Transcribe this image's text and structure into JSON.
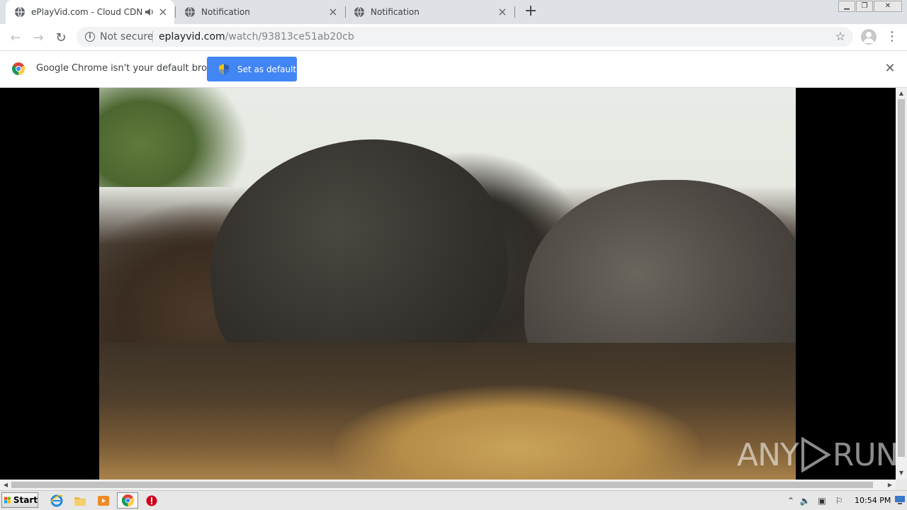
{
  "browser": {
    "tabs": [
      {
        "title": "ePlayVid.com - Cloud CDN",
        "active": true,
        "audio": true
      },
      {
        "title": "Notification",
        "active": false,
        "audio": false
      },
      {
        "title": "Notification",
        "active": false,
        "audio": false
      }
    ],
    "address": {
      "security_label": "Not secure",
      "host": "eplayvid.com",
      "path": "/watch/93813ce51ab20cb"
    }
  },
  "infobar": {
    "message": "Google Chrome isn't your default browser",
    "button_label": "Set as default"
  },
  "watermark": {
    "left": "ANY",
    "right": "RUN"
  },
  "taskbar": {
    "start_label": "Start",
    "clock": "10:54 PM"
  },
  "colors": {
    "accent": "#4285f4",
    "tabstrip": "#dee1e6",
    "taskbar": "#e7e7e7"
  },
  "icons": [
    "globe-icon",
    "speaker-icon",
    "close-icon",
    "plus-icon",
    "back-icon",
    "forward-icon",
    "reload-icon",
    "info-icon",
    "star-icon",
    "avatar-icon",
    "menu-icon",
    "chrome-icon",
    "shield-icon",
    "windows-flag-icon",
    "ie-icon",
    "folder-icon",
    "media-player-icon",
    "stop-icon",
    "play-logo-icon"
  ]
}
